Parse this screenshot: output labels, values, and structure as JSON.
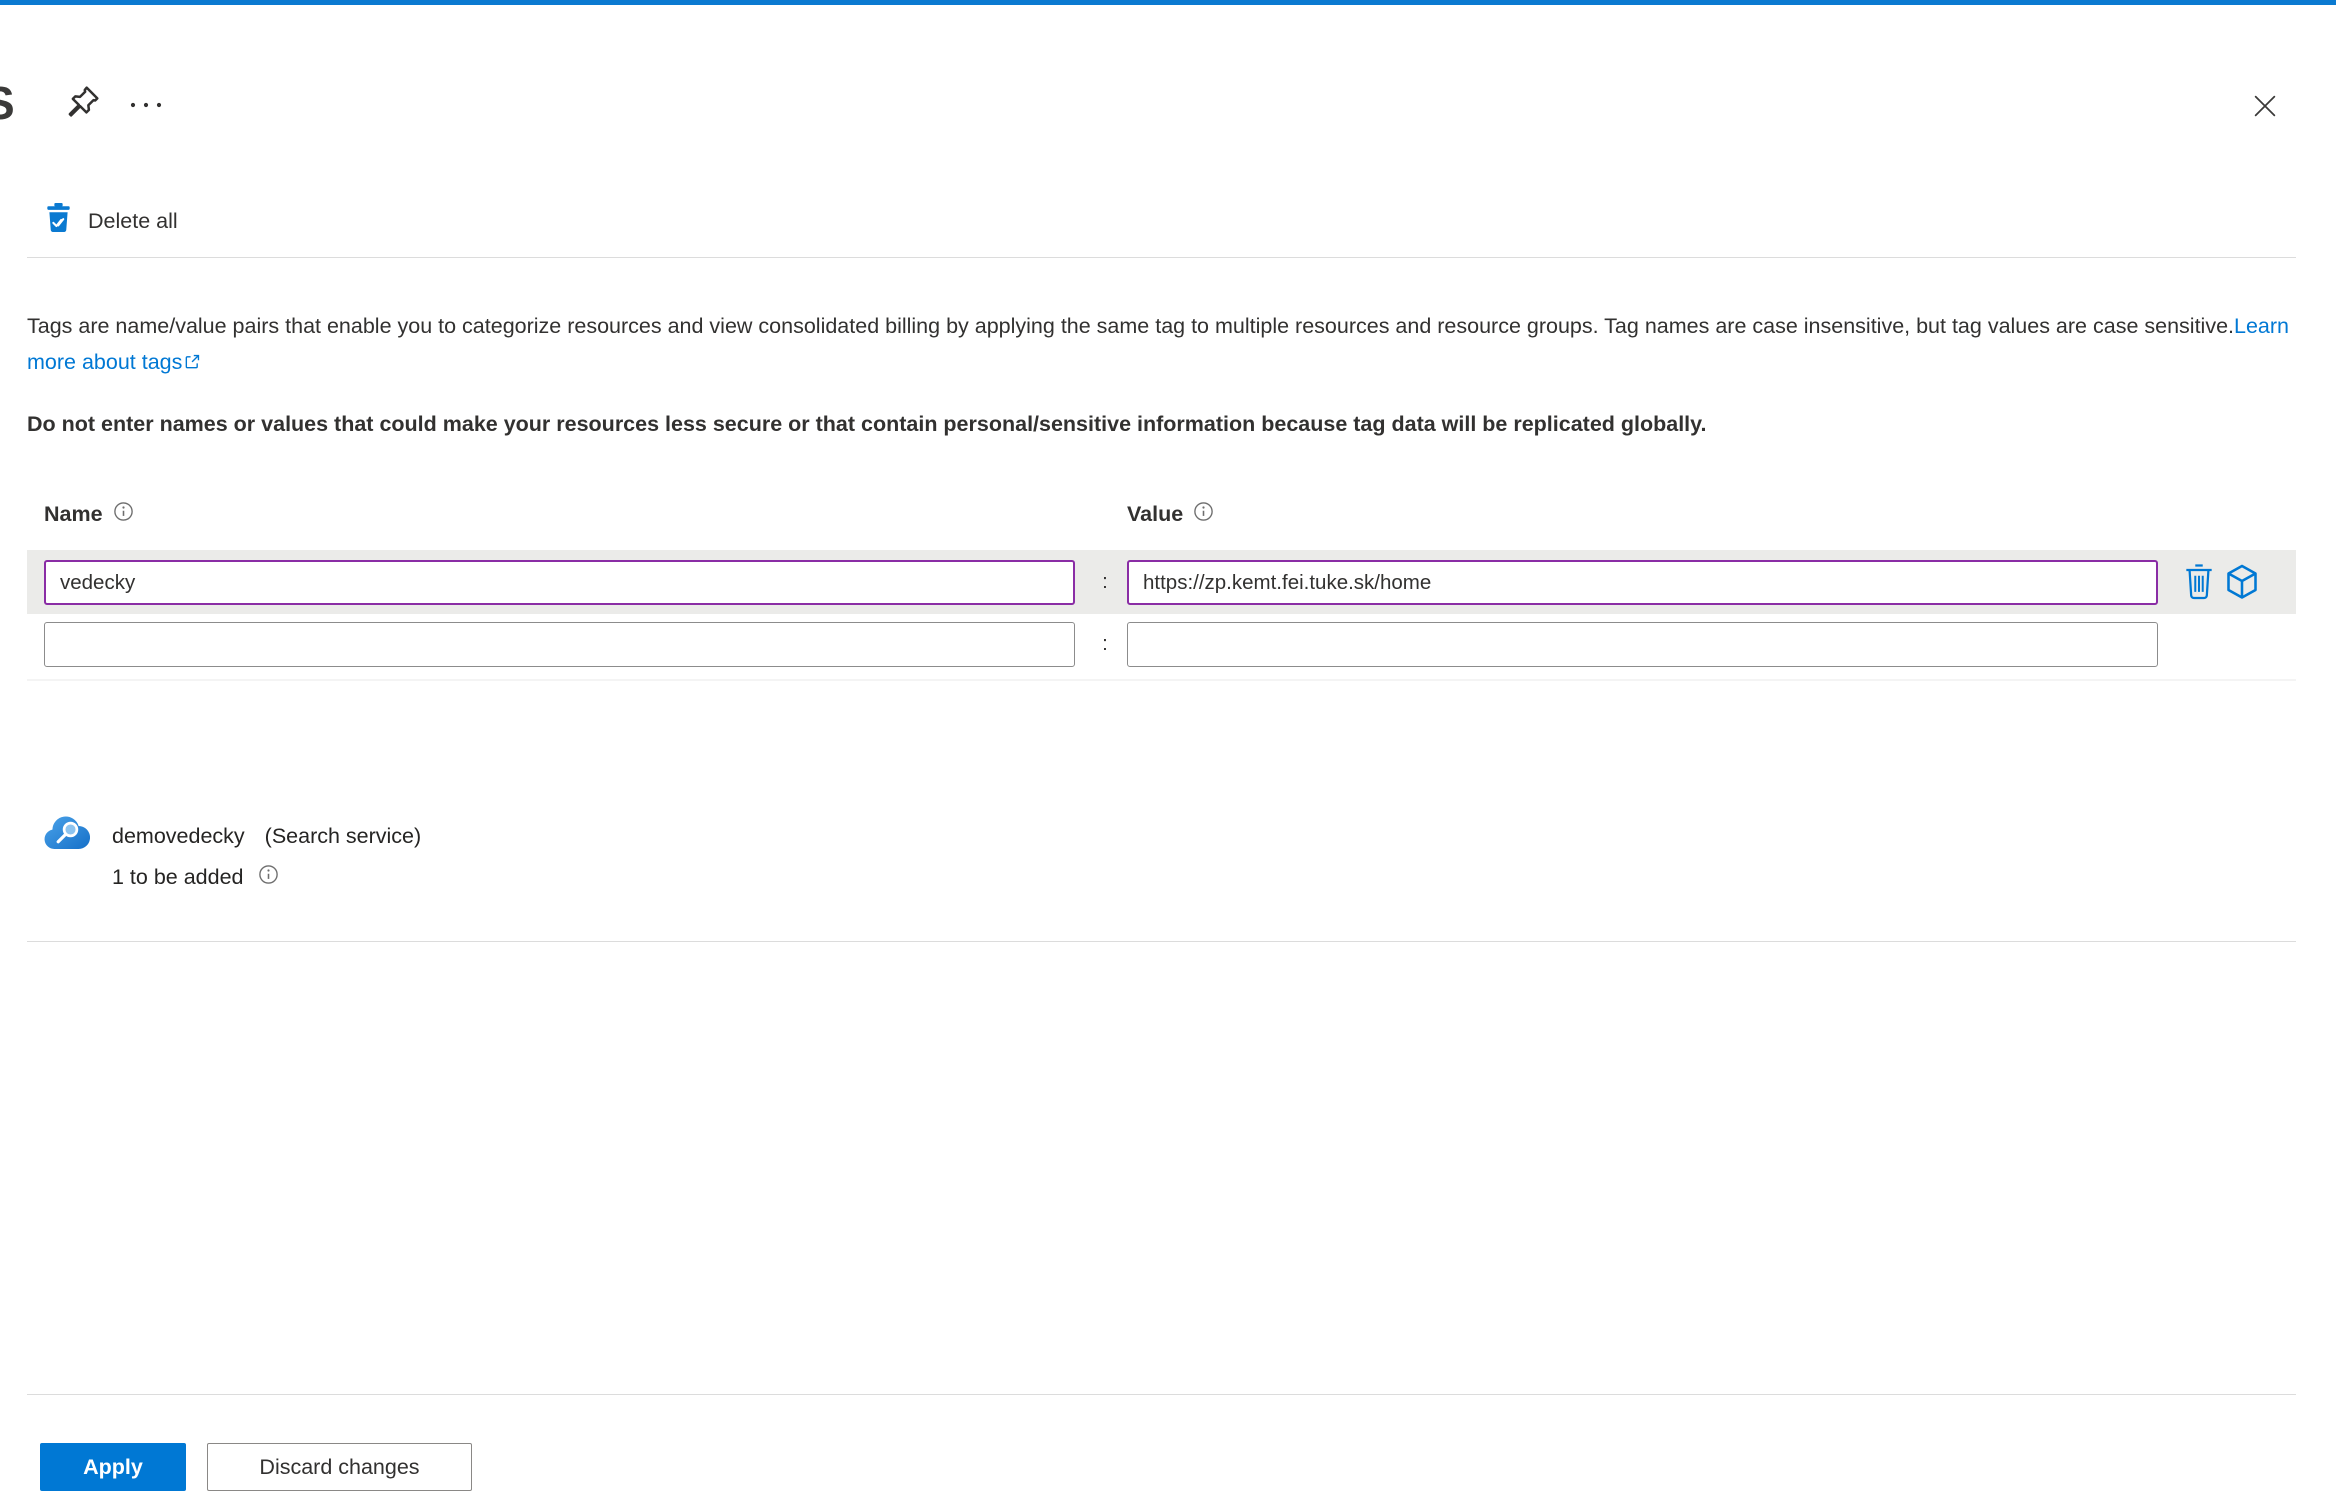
{
  "colors": {
    "accent_blue": "#0078d4",
    "top_bar_blue": "#0b7ad1",
    "modified_purple": "#8a2da5",
    "row_highlight": "#ebebe9"
  },
  "header": {
    "title_fragment": "S"
  },
  "commands": {
    "delete_all_label": "Delete all"
  },
  "intro": {
    "description": "Tags are name/value pairs that enable you to categorize resources and view consolidated billing by applying the same tag to multiple resources and resource groups. Tag names are case insensitive, but tag values are case sensitive.",
    "learn_more_label": "Learn more about tags",
    "warning": "Do not enter names or values that could make your resources less secure or that contain personal/sensitive information because tag data will be replicated globally."
  },
  "form": {
    "name_header": "Name",
    "value_header": "Value",
    "separator": ":",
    "rows": [
      {
        "name": "vedecky",
        "value": "https://zp.kemt.fei.tuke.sk/home",
        "modified": true
      },
      {
        "name": "",
        "value": "",
        "modified": false
      }
    ]
  },
  "resource": {
    "name": "demovedecky",
    "type": "(Search service)",
    "status": "1 to be added"
  },
  "footer": {
    "apply_label": "Apply",
    "discard_label": "Discard changes"
  }
}
